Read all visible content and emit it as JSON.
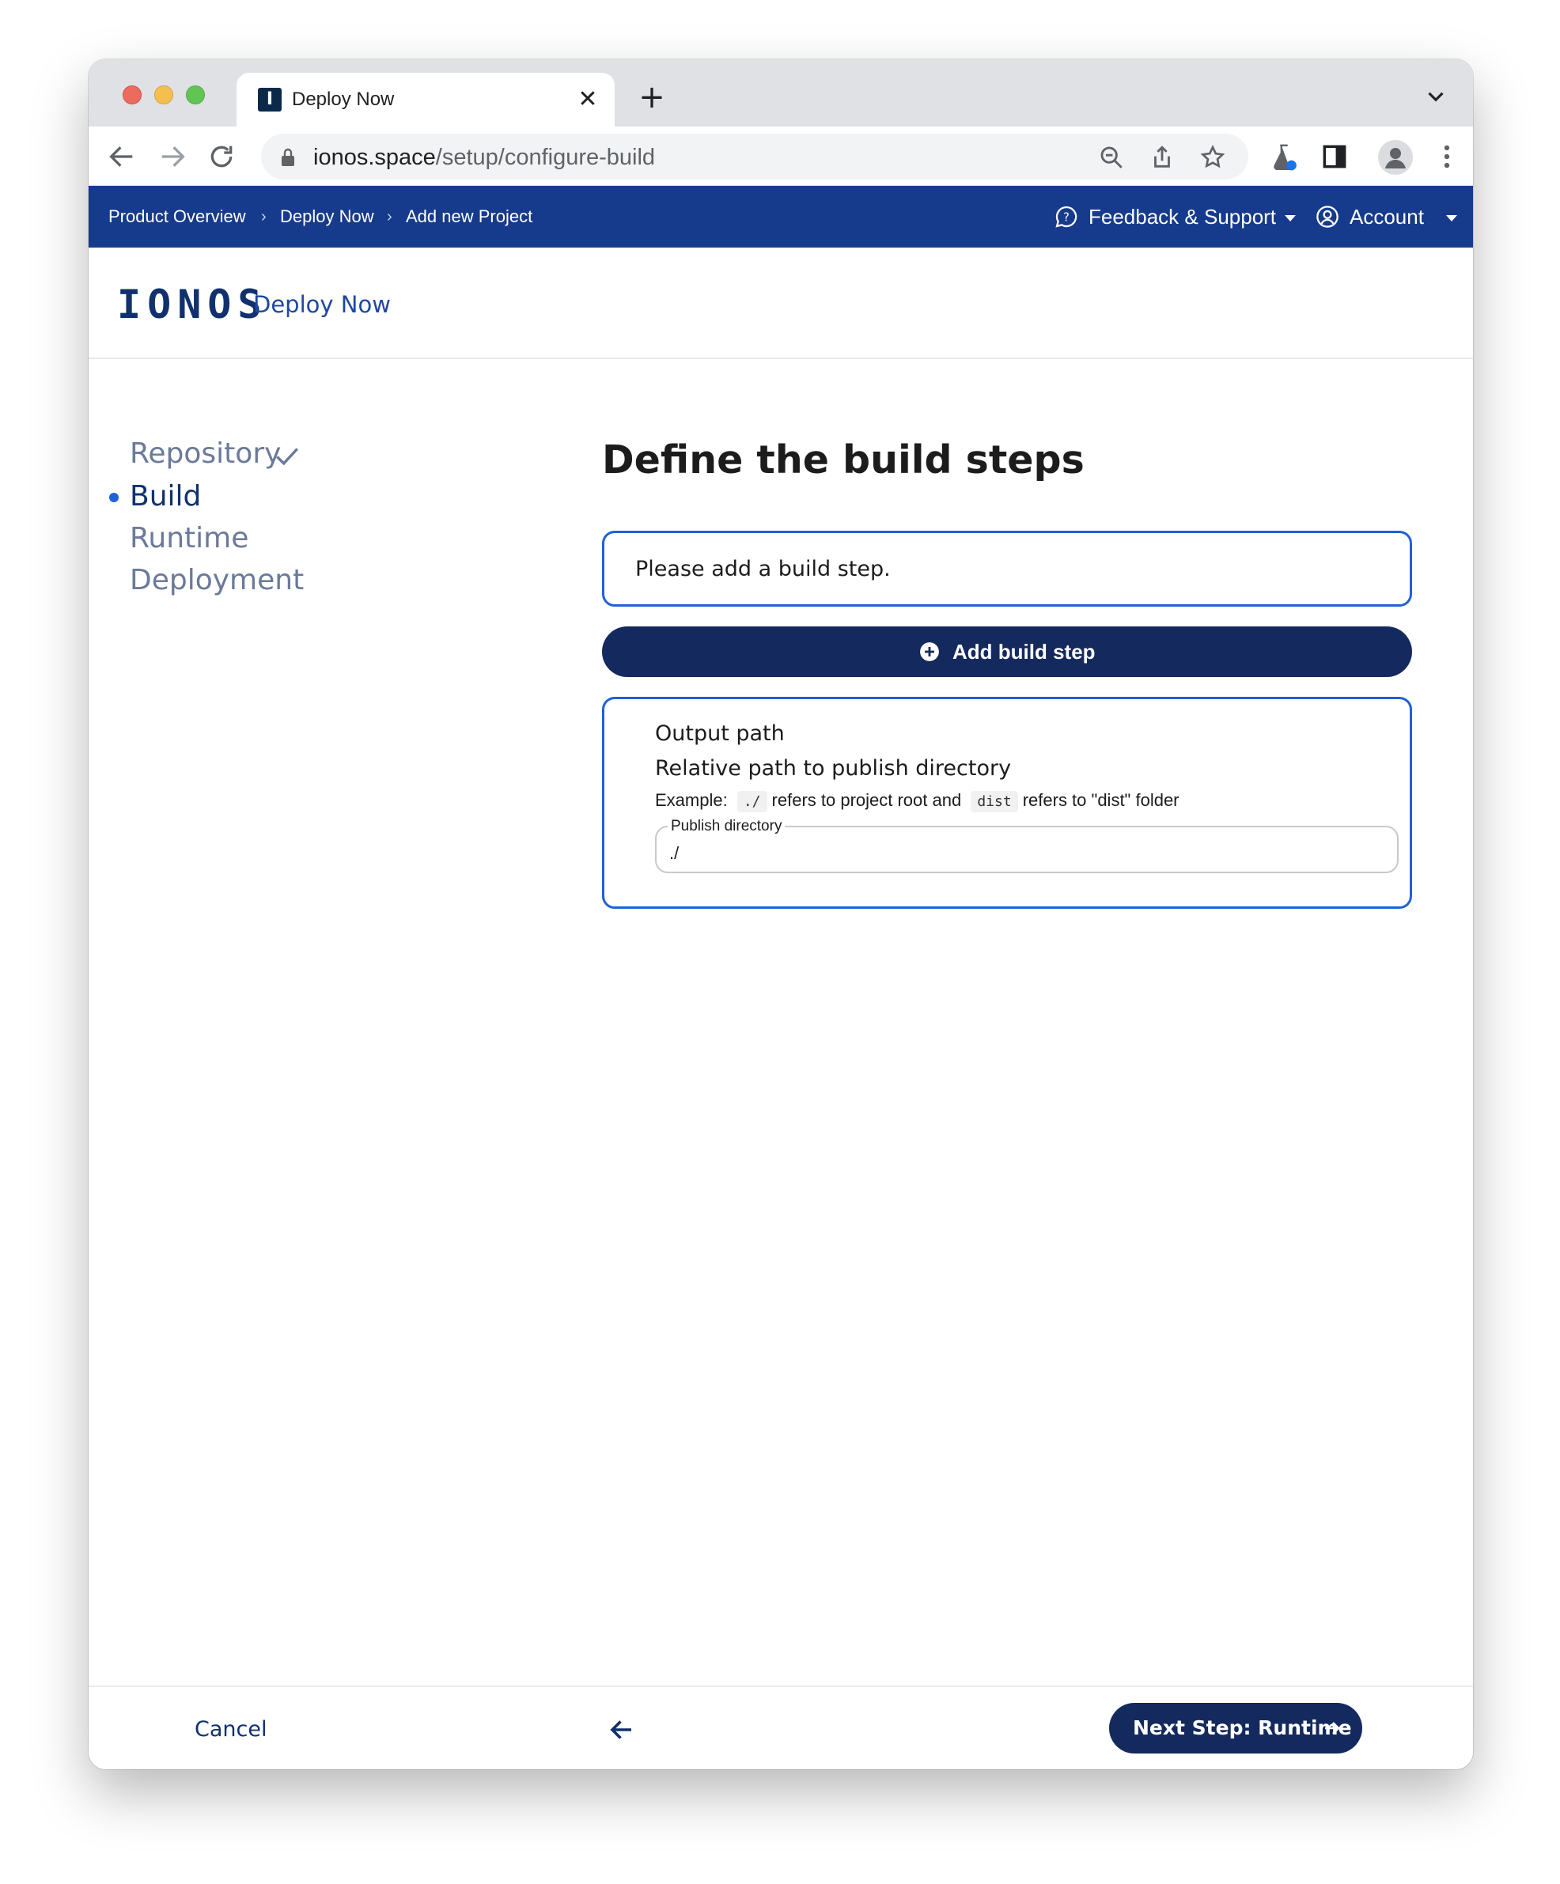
{
  "browser": {
    "tab_title": "Deploy Now",
    "favicon_letter": "I",
    "url_host": "ionos.space",
    "url_path": "/setup/configure-build"
  },
  "header": {
    "breadcrumbs": [
      "Product Overview",
      "Deploy Now",
      "Add new Project"
    ],
    "feedback_label": "Feedback & Support",
    "account_label": "Account"
  },
  "brand": {
    "logo_text": "IONOS",
    "product_name": "Deploy Now"
  },
  "steps": [
    {
      "label": "Repository",
      "state": "done"
    },
    {
      "label": "Build",
      "state": "active"
    },
    {
      "label": "Runtime",
      "state": "pending"
    },
    {
      "label": "Deployment",
      "state": "pending"
    }
  ],
  "main": {
    "title": "Define the build steps",
    "empty_message": "Please add a build step.",
    "add_button_label": "Add build step",
    "output": {
      "title": "Output path",
      "subtitle": "Relative path to publish directory",
      "example_prefix": "Example:",
      "example_code_1": "./",
      "example_mid": "refers to project root and",
      "example_code_2": "dist",
      "example_suffix": "refers to \"dist\" folder",
      "field_label": "Publish directory",
      "field_value": "./"
    }
  },
  "footer": {
    "cancel_label": "Cancel",
    "next_label": "Next Step: Runtime"
  },
  "colors": {
    "header_blue": "#163a8c",
    "button_navy": "#14295e",
    "accent_blue": "#1f61d9"
  }
}
